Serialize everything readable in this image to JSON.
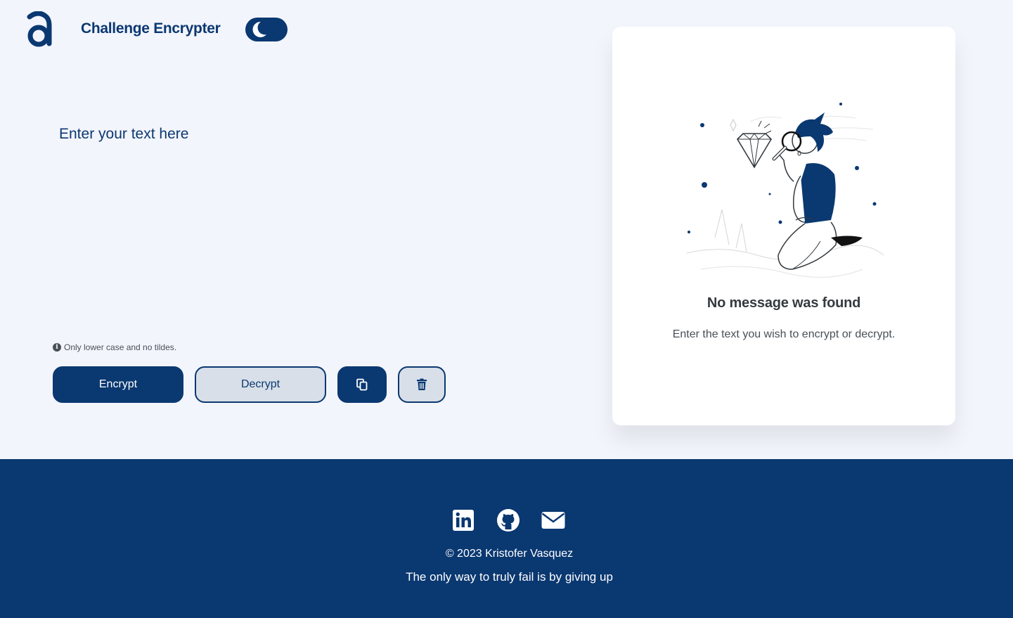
{
  "header": {
    "logo_icon": "alura-a-logo",
    "title": "Challenge Encrypter",
    "theme_toggle_icon": "moon-icon"
  },
  "editor": {
    "placeholder": "Enter your text here",
    "hint_icon": "info-icon",
    "hint": "Only lower case and no tildes."
  },
  "actions": {
    "encrypt_label": "Encrypt",
    "decrypt_label": "Decrypt",
    "copy_icon": "copy-icon",
    "clear_icon": "trash-icon"
  },
  "result": {
    "illustration": "person-with-magnifier-illustration",
    "title": "No message was found",
    "text": "Enter the text you wish to encrypt or decrypt."
  },
  "footer": {
    "social": [
      "linkedin-icon",
      "github-icon",
      "email-icon"
    ],
    "copyright": "© 2023 Kristofer Vasquez",
    "quote": "The only way to truly fail is by giving up"
  },
  "colors": {
    "primary": "#0a3871",
    "background": "#f3f5fc",
    "secondary_button": "#d8dfe8",
    "card": "#ffffff"
  }
}
